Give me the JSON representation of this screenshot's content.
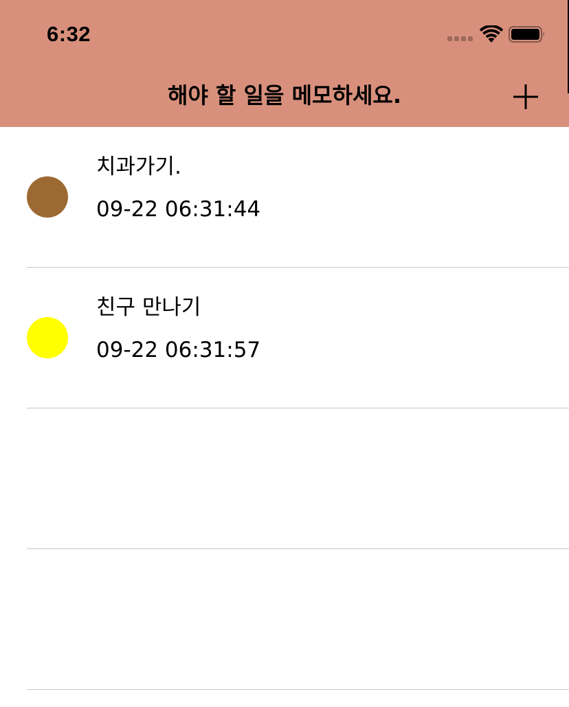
{
  "colors": {
    "nav_background": "#d8907c",
    "divider": "#c8c8c8",
    "background": "#ffffff",
    "text": "#000000"
  },
  "status_bar": {
    "time": "6:32",
    "cellular_icon": "cellular-signal-icon",
    "wifi_icon": "wifi-icon",
    "battery_icon": "battery-full-icon"
  },
  "nav": {
    "title": "해야 할 일을 메모하세요.",
    "add_icon": "plus-icon"
  },
  "memos": [
    {
      "title": "치과가기.",
      "timestamp": "09-22 06:31:44",
      "color": "#9c6932"
    },
    {
      "title": "친구 만나기",
      "timestamp": "09-22 06:31:57",
      "color": "#ffff00"
    },
    {
      "title": "",
      "timestamp": "",
      "color": ""
    },
    {
      "title": "",
      "timestamp": "",
      "color": ""
    }
  ]
}
